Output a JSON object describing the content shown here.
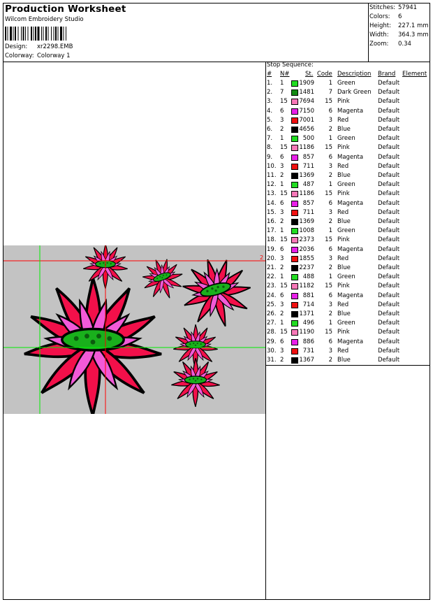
{
  "header": {
    "title": "Production Worksheet",
    "software": "Wilcom Embroidery Studio",
    "design_label": "Design:",
    "design_value": "xr2298.EMB",
    "colorway_label": "Colorway:",
    "colorway_value": "Colorway 1"
  },
  "stats": [
    {
      "label": "Stitches:",
      "value": "57941"
    },
    {
      "label": "Colors:",
      "value": "6"
    },
    {
      "label": "Height:",
      "value": "227.1 mm"
    },
    {
      "label": "Width:",
      "value": "364.3 mm"
    },
    {
      "label": "Zoom:",
      "value": "0.34"
    }
  ],
  "preview": {
    "marker": "2"
  },
  "sequence": {
    "title": "Stop Sequence:",
    "headers": {
      "num": "#",
      "n": "N#",
      "st": "St.",
      "code": "Code",
      "desc": "Description",
      "brand": "Brand",
      "element": "Element"
    },
    "rows": [
      {
        "num": "1.",
        "n": "1",
        "color": "#22dd22",
        "st": "1909",
        "code": "1",
        "desc": "Green",
        "brand": "Default"
      },
      {
        "num": "2.",
        "n": "7",
        "color": "#138a13",
        "st": "1481",
        "code": "7",
        "desc": "Dark Green",
        "brand": "Default"
      },
      {
        "num": "3.",
        "n": "15",
        "color": "#f878b8",
        "st": "7694",
        "code": "15",
        "desc": "Pink",
        "brand": "Default"
      },
      {
        "num": "4.",
        "n": "6",
        "color": "#e820e8",
        "st": "7150",
        "code": "6",
        "desc": "Magenta",
        "brand": "Default"
      },
      {
        "num": "5.",
        "n": "3",
        "color": "#f01010",
        "st": "7001",
        "code": "3",
        "desc": "Red",
        "brand": "Default"
      },
      {
        "num": "6.",
        "n": "2",
        "color": "#000000",
        "st": "4656",
        "code": "2",
        "desc": "Blue",
        "brand": "Default"
      },
      {
        "num": "7.",
        "n": "1",
        "color": "#22dd22",
        "st": "500",
        "code": "1",
        "desc": "Green",
        "brand": "Default"
      },
      {
        "num": "8.",
        "n": "15",
        "color": "#f878b8",
        "st": "1186",
        "code": "15",
        "desc": "Pink",
        "brand": "Default"
      },
      {
        "num": "9.",
        "n": "6",
        "color": "#e820e8",
        "st": "857",
        "code": "6",
        "desc": "Magenta",
        "brand": "Default"
      },
      {
        "num": "10.",
        "n": "3",
        "color": "#f01010",
        "st": "711",
        "code": "3",
        "desc": "Red",
        "brand": "Default"
      },
      {
        "num": "11.",
        "n": "2",
        "color": "#000000",
        "st": "1369",
        "code": "2",
        "desc": "Blue",
        "brand": "Default"
      },
      {
        "num": "12.",
        "n": "1",
        "color": "#22dd22",
        "st": "487",
        "code": "1",
        "desc": "Green",
        "brand": "Default"
      },
      {
        "num": "13.",
        "n": "15",
        "color": "#f878b8",
        "st": "1186",
        "code": "15",
        "desc": "Pink",
        "brand": "Default"
      },
      {
        "num": "14.",
        "n": "6",
        "color": "#e820e8",
        "st": "857",
        "code": "6",
        "desc": "Magenta",
        "brand": "Default"
      },
      {
        "num": "15.",
        "n": "3",
        "color": "#f01010",
        "st": "711",
        "code": "3",
        "desc": "Red",
        "brand": "Default"
      },
      {
        "num": "16.",
        "n": "2",
        "color": "#000000",
        "st": "1369",
        "code": "2",
        "desc": "Blue",
        "brand": "Default"
      },
      {
        "num": "17.",
        "n": "1",
        "color": "#22dd22",
        "st": "1008",
        "code": "1",
        "desc": "Green",
        "brand": "Default"
      },
      {
        "num": "18.",
        "n": "15",
        "color": "#f878b8",
        "st": "2373",
        "code": "15",
        "desc": "Pink",
        "brand": "Default"
      },
      {
        "num": "19.",
        "n": "6",
        "color": "#e820e8",
        "st": "2036",
        "code": "6",
        "desc": "Magenta",
        "brand": "Default"
      },
      {
        "num": "20.",
        "n": "3",
        "color": "#f01010",
        "st": "1855",
        "code": "3",
        "desc": "Red",
        "brand": "Default"
      },
      {
        "num": "21.",
        "n": "2",
        "color": "#000000",
        "st": "2237",
        "code": "2",
        "desc": "Blue",
        "brand": "Default"
      },
      {
        "num": "22.",
        "n": "1",
        "color": "#22dd22",
        "st": "488",
        "code": "1",
        "desc": "Green",
        "brand": "Default"
      },
      {
        "num": "23.",
        "n": "15",
        "color": "#f878b8",
        "st": "1182",
        "code": "15",
        "desc": "Pink",
        "brand": "Default"
      },
      {
        "num": "24.",
        "n": "6",
        "color": "#e820e8",
        "st": "881",
        "code": "6",
        "desc": "Magenta",
        "brand": "Default"
      },
      {
        "num": "25.",
        "n": "3",
        "color": "#f01010",
        "st": "714",
        "code": "3",
        "desc": "Red",
        "brand": "Default"
      },
      {
        "num": "26.",
        "n": "2",
        "color": "#000000",
        "st": "1371",
        "code": "2",
        "desc": "Blue",
        "brand": "Default"
      },
      {
        "num": "27.",
        "n": "1",
        "color": "#22dd22",
        "st": "496",
        "code": "1",
        "desc": "Green",
        "brand": "Default"
      },
      {
        "num": "28.",
        "n": "15",
        "color": "#f878b8",
        "st": "1190",
        "code": "15",
        "desc": "Pink",
        "brand": "Default"
      },
      {
        "num": "29.",
        "n": "6",
        "color": "#e820e8",
        "st": "886",
        "code": "6",
        "desc": "Magenta",
        "brand": "Default"
      },
      {
        "num": "30.",
        "n": "3",
        "color": "#f01010",
        "st": "731",
        "code": "3",
        "desc": "Red",
        "brand": "Default"
      },
      {
        "num": "31.",
        "n": "2",
        "color": "#000000",
        "st": "1367",
        "code": "2",
        "desc": "Blue",
        "brand": "Default"
      }
    ]
  }
}
